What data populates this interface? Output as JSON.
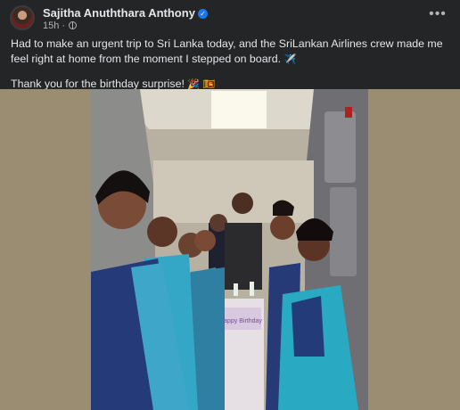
{
  "post": {
    "author": "Sajitha Anuththara Anthony",
    "time": "15h",
    "separator": "·",
    "more_label": "•••",
    "paragraphs": [
      "Had to make an urgent trip to Sri Lanka today, and the SriLankan Airlines crew made me feel right at home from the moment I stepped on board.",
      "Thank you for the birthday surprise!"
    ],
    "emojis": [
      "✈️",
      "🎉",
      "🇱🇰"
    ],
    "icons": {
      "verified": "verified-badge-icon",
      "audience": "globe-icon",
      "more": "more-options-icon"
    }
  },
  "colors": {
    "post_background": "#242526",
    "text_primary": "#e4e6eb",
    "text_secondary": "#b0b3b8",
    "verified_blue": "#1877f2",
    "photo_backdrop": "#9a8d71"
  },
  "photo": {
    "cake_text": "Happy Birthday"
  }
}
